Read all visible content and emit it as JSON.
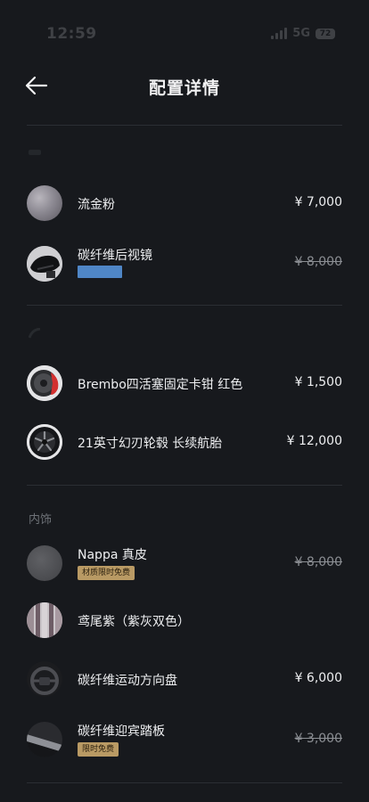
{
  "status_bar": {
    "time": "12:59",
    "network": "5G",
    "battery": "72"
  },
  "header": {
    "title": "配置详情",
    "back_icon": "arrow-left-icon"
  },
  "sections": {
    "interior_label": "内饰"
  },
  "items": [
    {
      "name": "流金粉",
      "price": "¥ 7,000",
      "struck": false,
      "icon": "paint-swatch-icon"
    },
    {
      "name": "碳纤维后视镜",
      "price": "¥ 8,000",
      "struck": true,
      "icon": "mirror-icon",
      "chip_color": "#4f86c6"
    },
    {
      "name": "Brembo四活塞固定卡钳 红色",
      "price": "¥ 1,500",
      "struck": false,
      "icon": "brake-caliper-icon"
    },
    {
      "name": "21英寸幻刃轮毂 长续航胎",
      "price": "¥ 12,000",
      "struck": false,
      "icon": "wheel-icon"
    },
    {
      "name": "Nappa 真皮",
      "price": "¥ 8,000",
      "struck": true,
      "icon": "leather-swatch-icon",
      "tag": "材质限时免费"
    },
    {
      "name": "鸢尾紫（紫灰双色）",
      "price": "",
      "struck": false,
      "icon": "interior-color-icon"
    },
    {
      "name": "碳纤维运动方向盘",
      "price": "¥ 6,000",
      "struck": false,
      "icon": "steering-wheel-icon"
    },
    {
      "name": "碳纤维迎宾踏板",
      "price": "¥ 3,000",
      "struck": true,
      "icon": "door-sill-icon",
      "tag": "限时免费"
    }
  ],
  "colors": {
    "background": "#17191d",
    "tag_gold": "#b99a64",
    "chip_blue": "#4f86c6"
  }
}
